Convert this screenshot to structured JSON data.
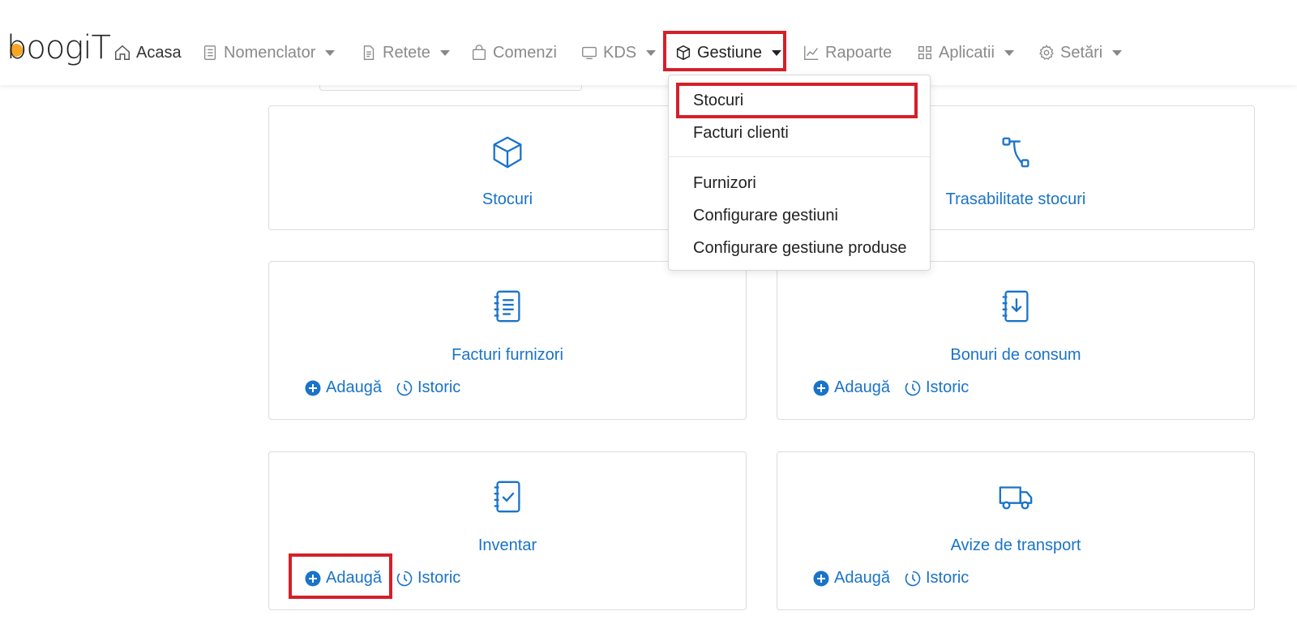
{
  "app": {
    "logo_text": "boogiT"
  },
  "nav": {
    "items": [
      {
        "label": "Acasa",
        "icon": "home-icon"
      },
      {
        "label": "Nomenclator",
        "icon": "list-doc-icon"
      },
      {
        "label": "Retete",
        "icon": "document-icon"
      },
      {
        "label": "Comenzi",
        "icon": "bag-icon"
      },
      {
        "label": "KDS",
        "icon": "monitor-icon"
      },
      {
        "label": "Gestiune",
        "icon": "box-icon",
        "active": true
      },
      {
        "label": "Rapoarte",
        "icon": "chart-line-icon"
      },
      {
        "label": "Aplicatii",
        "icon": "grid-icon"
      },
      {
        "label": "Setări",
        "icon": "gear-icon"
      }
    ]
  },
  "dropdown": {
    "items": [
      "Stocuri",
      "Facturi clienti",
      "Furnizori",
      "Configurare gestiuni",
      "Configurare gestiune produse"
    ]
  },
  "cards": [
    {
      "title": "Stocuri",
      "icon": "cube-icon"
    },
    {
      "title": "Trasabilitate stocuri",
      "icon": "flow-icon"
    },
    {
      "title": "Facturi furnizori",
      "icon": "notebook-list-icon",
      "add": "Adaugă",
      "history": "Istoric"
    },
    {
      "title": "Bonuri de consum",
      "icon": "notebook-download-icon",
      "add": "Adaugă",
      "history": "Istoric"
    },
    {
      "title": "Inventar",
      "icon": "notebook-check-icon",
      "add": "Adaugă",
      "history": "Istoric"
    },
    {
      "title": "Avize de transport",
      "icon": "truck-icon",
      "add": "Adaugă",
      "history": "Istoric"
    }
  ],
  "colors": {
    "accent": "#1a73c8",
    "highlight": "#d4202a",
    "logo_dot": "#f5a623"
  }
}
